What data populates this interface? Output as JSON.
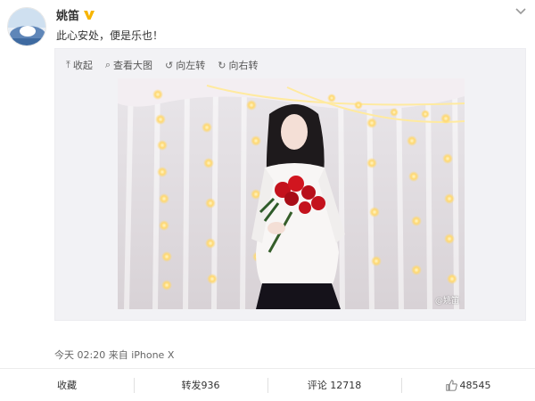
{
  "user": {
    "name": "姚笛",
    "badge_icon": "verified-v-badge",
    "badge_color": "#f7b500"
  },
  "post": {
    "text": "此心安处，便是乐也！"
  },
  "toolbar": {
    "collapse_label": "收起",
    "collapse_icon": "upload-arrow-icon",
    "view_large_label": "查看大图",
    "view_large_icon": "magnify-icon",
    "rotate_left_label": "向左转",
    "rotate_left_icon": "rotate-left-icon",
    "rotate_right_label": "向右转",
    "rotate_right_icon": "rotate-right-icon"
  },
  "photo": {
    "watermark": "@姚笛"
  },
  "meta": {
    "line": "今天 02:20 来自 iPhone X"
  },
  "actions": {
    "favorite_label": "收藏",
    "repost_label": "转发936",
    "comment_label": "评论 12718",
    "like_count": "48545",
    "like_icon": "thumbs-up-icon"
  }
}
